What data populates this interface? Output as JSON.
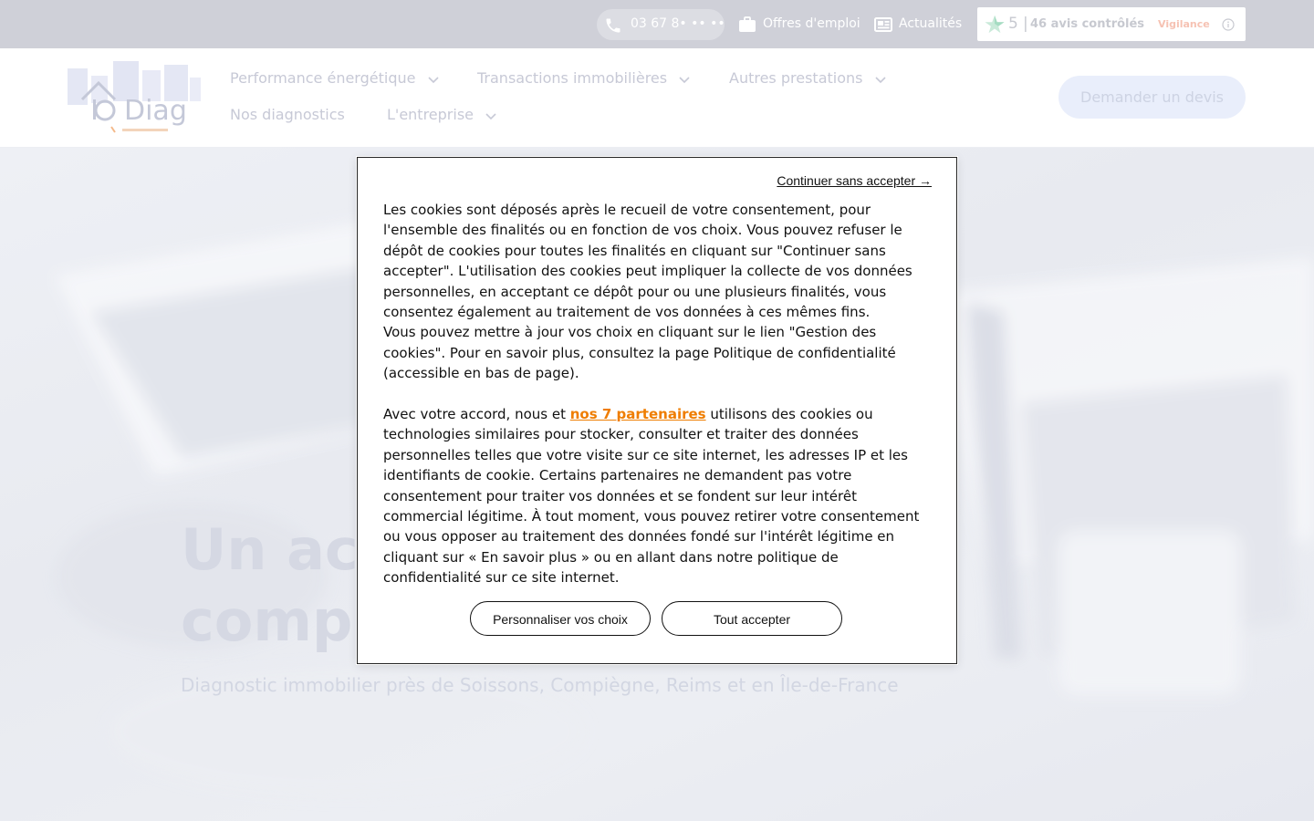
{
  "topbar": {
    "phone": "03 67 8• •• ••",
    "jobs": "Offres d'emploi",
    "news": "Actualités",
    "review": {
      "score": "5",
      "separator": "|",
      "count": "46 avis contrôlés",
      "badge": "Vigilance"
    }
  },
  "nav": {
    "logo_text": "Diag",
    "items": [
      {
        "label": "Performance énergétique"
      },
      {
        "label": "Transactions immobilières"
      },
      {
        "label": "Autres prestations"
      },
      {
        "label": "Nos diagnostics"
      },
      {
        "label": "L'entreprise"
      }
    ],
    "cta": "Demander un devis"
  },
  "hero": {
    "title_line1": "Un acc",
    "title_line2": "comp",
    "subtitle": "Diagnostic immobilier près de Soissons, Compiègne, Reims et en Île-de-France"
  },
  "cookie": {
    "skip": "Continuer sans accepter →",
    "para1": "Les cookies sont déposés après le recueil de votre consentement, pour l'ensemble des finalités ou en fonction de vos choix. Vous pouvez refuser le dépôt de cookies pour toutes les finalités en cliquant sur \"Continuer sans accepter\". L'utilisation des cookies peut impliquer la collecte de vos données personnelles, en acceptant ce dépôt pour ou une plusieurs finalités, vous consentez également au traitement de vos données à ces mêmes fins.",
    "para2": "Vous pouvez mettre à jour vos choix en cliquant sur le lien \"Gestion des cookies\". Pour en savoir plus, consultez la page Politique de confidentialité (accessible en bas de page).",
    "para3_pre": "Avec votre accord, nous et ",
    "para3_link": "nos 7 partenaires",
    "para3_post": " utilisons des cookies ou technologies similaires pour stocker, consulter et traiter des données personnelles telles que votre visite sur ce site internet, les adresses IP et les identifiants de cookie. Certains partenaires ne demandent pas votre consentement pour traiter vos données et se fondent sur leur intérêt commercial légitime. À tout moment, vous pouvez retirer votre consentement ou vous opposer au traitement des données fondé sur l'intérêt légitime en cliquant sur « En savoir plus » ou en allant dans notre politique de confidentialité sur ce site internet.",
    "btn_customize": "Personnaliser vos choix",
    "btn_accept": "Tout accepter"
  },
  "colors": {
    "accent_orange": "#ef7d00",
    "topbar_bg": "#cfd0d8",
    "review_star": "#00b67a"
  }
}
